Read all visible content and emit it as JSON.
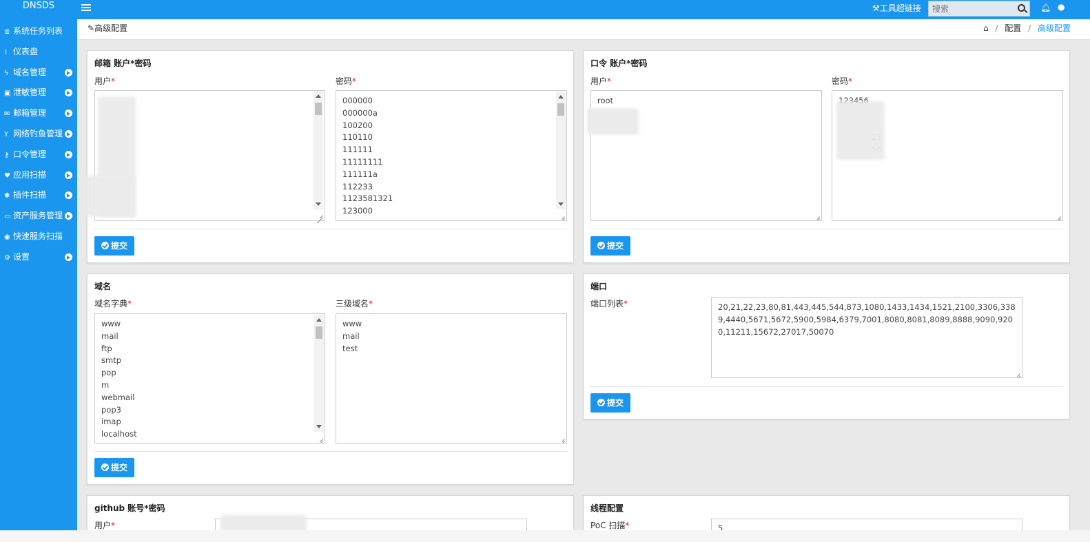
{
  "app": {
    "brand": "DNSDS",
    "tools_link": "工具超链接",
    "search_placeholder": "搜索"
  },
  "sidebar": {
    "items": [
      {
        "icon": "list-icon",
        "glyph": "≣",
        "label": "系统任务列表",
        "has_arrow": false
      },
      {
        "icon": "chart-icon",
        "glyph": "⌇",
        "label": "仪表盘",
        "has_arrow": false
      },
      {
        "icon": "bolt-icon",
        "glyph": "ϟ",
        "label": "域名管理",
        "has_arrow": true
      },
      {
        "icon": "leak-icon",
        "glyph": "▣",
        "label": "泄敏管理",
        "has_arrow": true
      },
      {
        "icon": "mail-icon",
        "glyph": "✉",
        "label": "邮箱管理",
        "has_arrow": true
      },
      {
        "icon": "phishing-icon",
        "glyph": "Y",
        "label": "网络钓鱼管理",
        "has_arrow": true
      },
      {
        "icon": "key-icon",
        "glyph": "⚷",
        "label": "口令管理",
        "has_arrow": true
      },
      {
        "icon": "heart-icon",
        "glyph": "♥",
        "label": "应用扫描",
        "has_arrow": true
      },
      {
        "icon": "bug-icon",
        "glyph": "✱",
        "label": "插件扫描",
        "has_arrow": true
      },
      {
        "icon": "calendar-icon",
        "glyph": "▭",
        "label": "资产服务管理",
        "has_arrow": true
      },
      {
        "icon": "target-icon",
        "glyph": "◉",
        "label": "快速服务扫描",
        "has_arrow": false
      },
      {
        "icon": "gears-icon",
        "glyph": "⚙",
        "label": "设置",
        "has_arrow": true
      }
    ]
  },
  "header": {
    "title": "高级配置",
    "breadcrumb": [
      "配置",
      "高级配置"
    ]
  },
  "panels": {
    "email": {
      "title": "邮箱 账户*密码",
      "user_label": "用户",
      "password_label": "密码",
      "user_lines": "\n\n\n\n\n\n\n\n\n\n\n\n\n\n    ,\n       n\n  a",
      "password_lines": "000000\n000000a\n100200\n110110\n111111\n11111111\n111111a\n112233\n1123581321\n123000",
      "submit": "提交"
    },
    "password": {
      "title": "口令 账户*密码",
      "user_label": "用户",
      "password_label": "密码",
      "user_lines": "root",
      "password_lines": "123456\n\n\n             23\n             56",
      "submit": "提交"
    },
    "domain": {
      "title": "域名",
      "dict_label": "域名字典",
      "third_label": "三级域名",
      "dict_lines": "www\nmail\nftp\nsmtp\npop\nm\nwebmail\npop3\nimap\nlocalhost",
      "third_lines": "www\nmail\ntest",
      "submit": "提交"
    },
    "port": {
      "title": "端口",
      "list_label": "端口列表",
      "ports": "20,21,22,23,80,81,443,445,544,873,1080,1433,1434,1521,2100,3306,3389,4440,5671,5672,5900,5984,6379,7001,8080,8081,8089,8888,9090,9200,11211,15672,27017,50070",
      "submit": "提交"
    },
    "github": {
      "title": "github 账号*密码",
      "user_label": "用户"
    },
    "thread": {
      "title": "线程配置",
      "poc_label": "PoC 扫描",
      "poc_value": "5"
    }
  }
}
